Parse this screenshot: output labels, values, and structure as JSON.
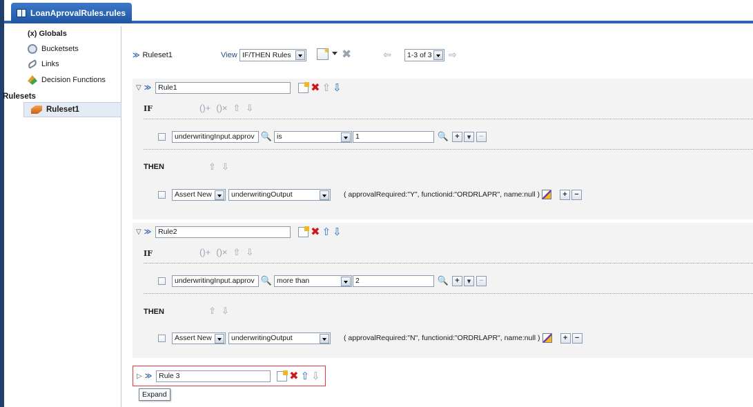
{
  "tab": {
    "title": "LoanAprovalRules.rules"
  },
  "sidebar": {
    "items": [
      {
        "label": "(x) Globals",
        "icon": "globals-icon"
      },
      {
        "label": "Bucketsets",
        "icon": "bucketsets-icon"
      },
      {
        "label": "Links",
        "icon": "links-icon"
      },
      {
        "label": "Decision Functions",
        "icon": "decision-functions-icon"
      }
    ],
    "section_label": "Rulesets",
    "selected_ruleset": "Ruleset1"
  },
  "toolbar": {
    "ruleset_name": "Ruleset1",
    "view_label": "View",
    "view_value": "IF/THEN Rules",
    "pager": "1-3 of 3"
  },
  "rules": [
    {
      "name": "Rule1",
      "if_label": "IF",
      "then_label": "THEN",
      "condition": {
        "left": "underwritingInput.approv",
        "operator": "is",
        "right": "1"
      },
      "action": {
        "type": "Assert New",
        "target": "underwritingOutput",
        "params": "( approvalRequired:\"Y\", functionid:\"ORDRLAPR\", name:null )"
      }
    },
    {
      "name": "Rule2",
      "if_label": "IF",
      "then_label": "THEN",
      "condition": {
        "left": "underwritingInput.approv",
        "operator": "more than",
        "right": "2"
      },
      "action": {
        "type": "Assert New",
        "target": "underwritingOutput",
        "params": "( approvalRequired:\"N\", functionid:\"ORDRLAPR\", name:null )"
      }
    },
    {
      "name": "Rule 3"
    }
  ],
  "tooltip": "Expand"
}
